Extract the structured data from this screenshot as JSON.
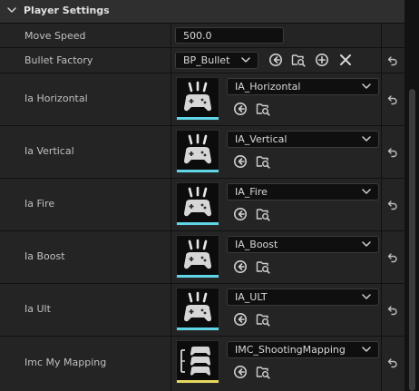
{
  "section": {
    "title": "Player Settings"
  },
  "properties": {
    "move_speed": {
      "label": "Move Speed",
      "value": "500.0"
    },
    "bullet_factory": {
      "label": "Bullet Factory",
      "value": "BP_Bullet"
    },
    "ia_horizontal": {
      "label": "Ia Horizontal",
      "value": "IA_Horizontal"
    },
    "ia_vertical": {
      "label": "Ia Vertical",
      "value": "IA_Vertical"
    },
    "ia_fire": {
      "label": "Ia Fire",
      "value": "IA_Fire"
    },
    "ia_boost": {
      "label": "Ia Boost",
      "value": "IA_Boost"
    },
    "ia_ult": {
      "label": "Ia Ult",
      "value": "IA_ULT"
    },
    "imc_mapping": {
      "label": "Imc My Mapping",
      "value": "IMC_ShootingMapping"
    }
  },
  "icons": {
    "input_action": "gamepad-input-action-icon",
    "mapping_context": "mapping-context-icon",
    "use_selected": "use-selected-arrow-icon",
    "browse": "browse-folder-icon",
    "add": "add-circle-icon",
    "clear": "clear-x-icon",
    "reset": "reset-to-default-icon"
  },
  "colors": {
    "input_action_bar": "#5fd5e6",
    "mapping_context_bar": "#e6d85f",
    "panel_bg": "#242424",
    "header_bg": "#2f2f2f"
  }
}
